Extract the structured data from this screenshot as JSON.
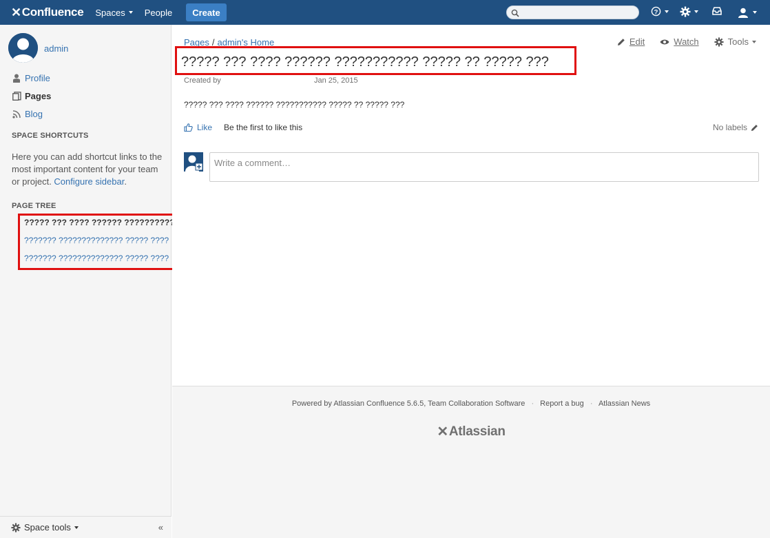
{
  "header": {
    "logo_text": "Confluence",
    "nav": {
      "spaces": "Spaces",
      "people": "People"
    },
    "create_label": "Create",
    "search_placeholder": "",
    "icons": [
      "help-icon",
      "settings-icon",
      "notifications-icon",
      "user-icon"
    ]
  },
  "sidebar": {
    "user": "admin",
    "links": {
      "profile": "Profile",
      "pages": "Pages",
      "blog": "Blog"
    },
    "shortcuts_heading": "SPACE SHORTCUTS",
    "shortcuts_text": "Here you can add shortcut links to the most important content for your team or project. ",
    "configure_link": "Configure sidebar",
    "period": ".",
    "tree_heading": "PAGE TREE",
    "tree_items": [
      "????? ??? ???? ?????? ???????????",
      "??????? ?????????????? ????? ????",
      "??????? ?????????????? ????? ????"
    ],
    "space_tools": "Space tools",
    "collapse": "«"
  },
  "page": {
    "breadcrumb": {
      "pages": "Pages",
      "sep": "/",
      "home": "admin's Home"
    },
    "actions": {
      "edit": "Edit",
      "watch": "Watch",
      "tools": "Tools"
    },
    "title": "????? ??? ???? ?????? ??????????? ????? ?? ????? ???",
    "created_by": "Created by",
    "date": "Jan 25, 2015",
    "body": "????? ??? ???? ?????? ??????????? ????? ?? ????? ???",
    "like": "Like",
    "like_text": "Be the first to like this",
    "labels": "No labels",
    "comment_placeholder": "Write a comment…"
  },
  "footer": {
    "powered": "Powered by Atlassian Confluence 5.6.5, Team Collaboration Software",
    "report": "Report a bug",
    "news": "Atlassian News",
    "dot": "·",
    "logo_text": "Atlassian"
  },
  "colors": {
    "header": "#205081",
    "link": "#3572b0",
    "highlight": "#e01010"
  }
}
